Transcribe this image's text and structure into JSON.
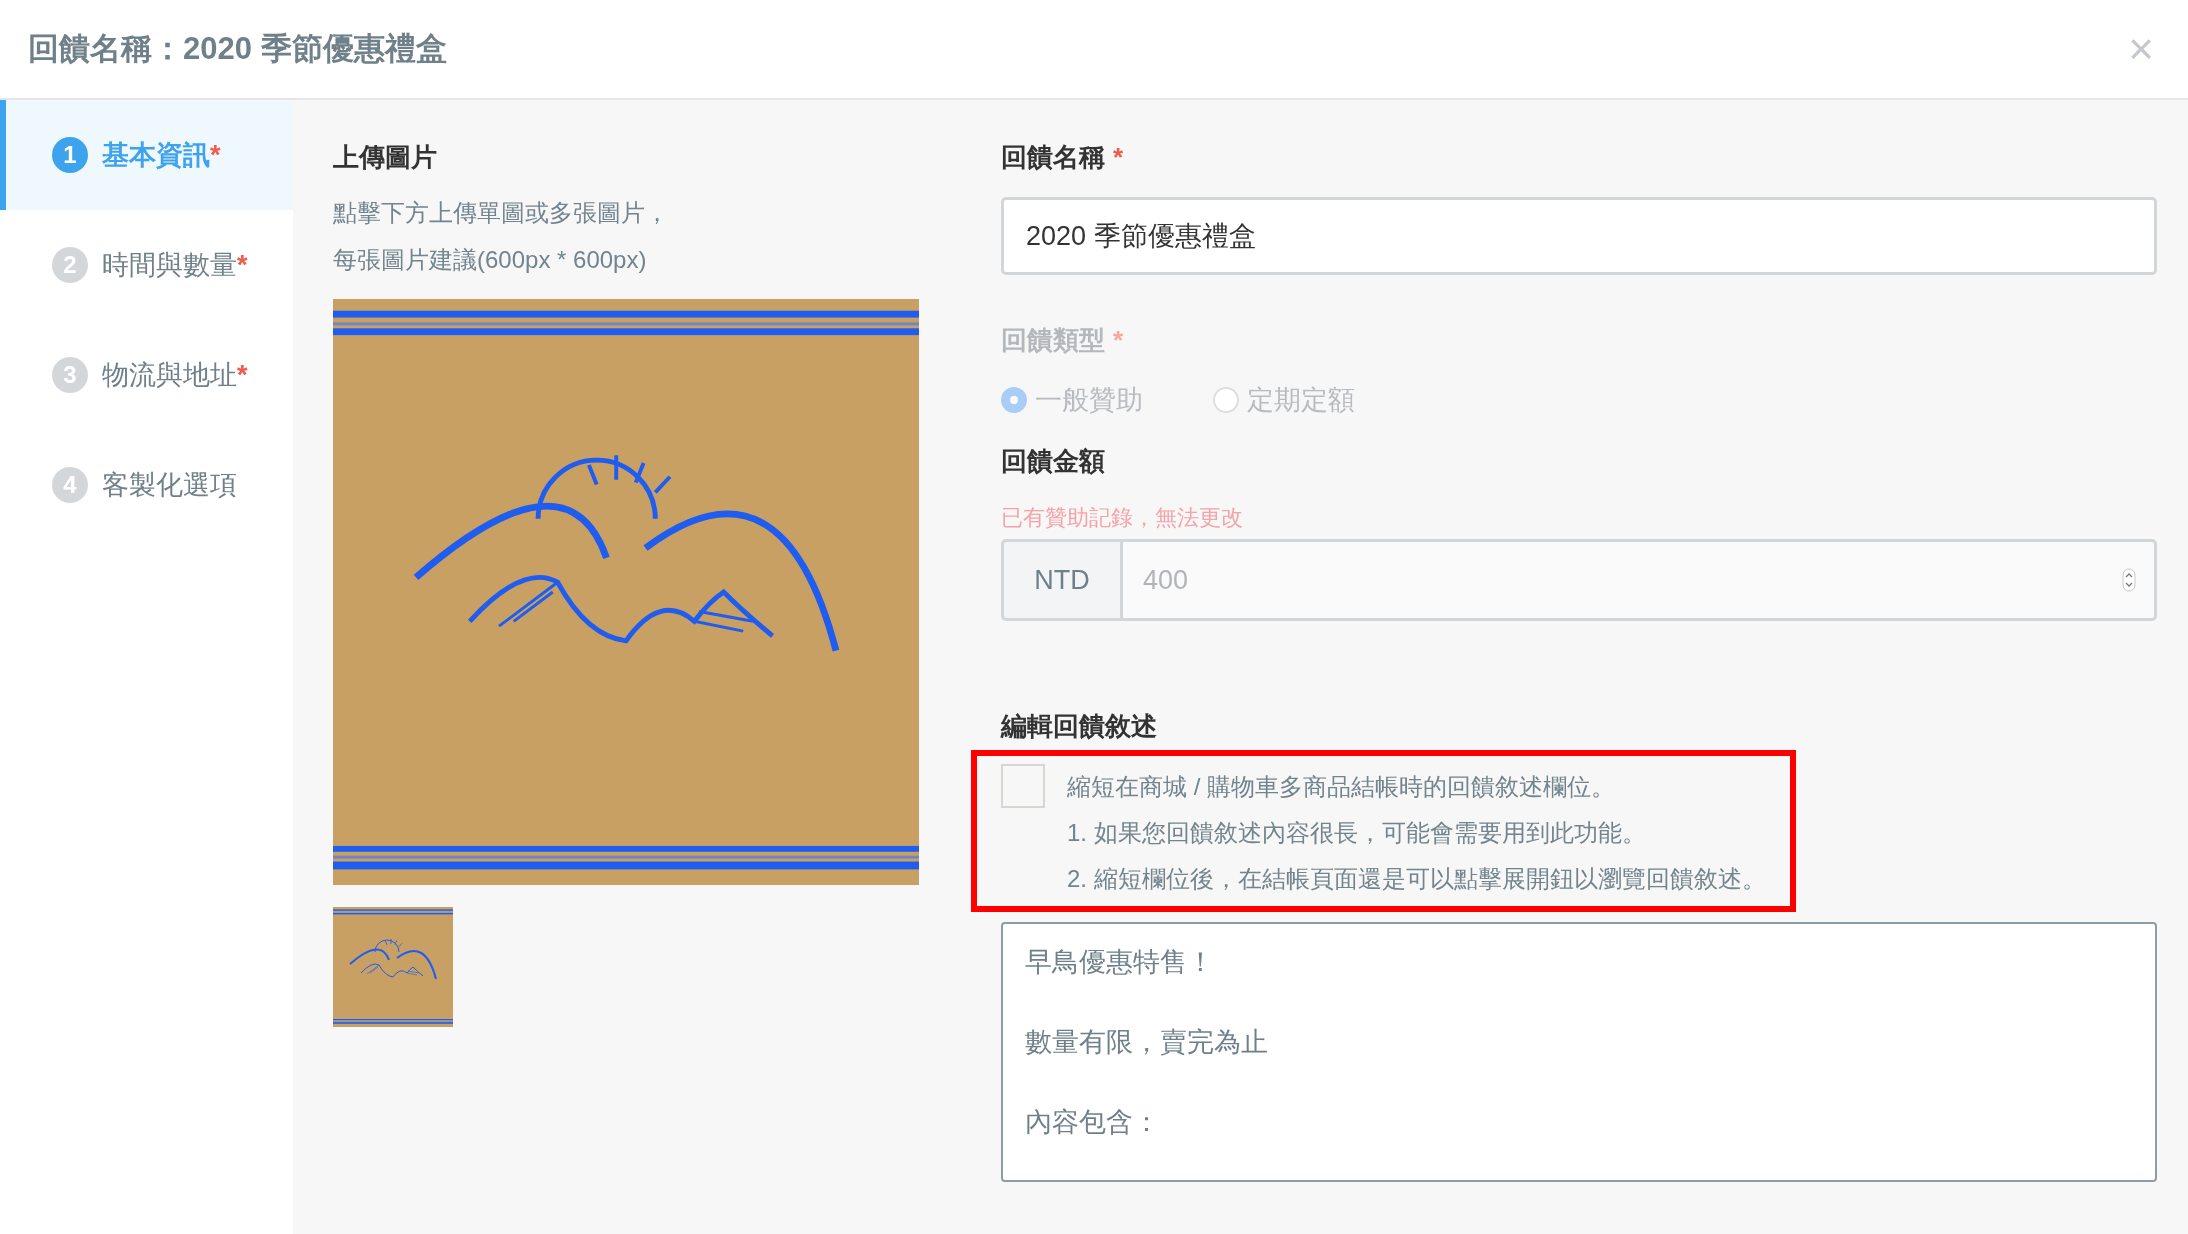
{
  "dialog": {
    "title": "回饋名稱：2020 季節優惠禮盒",
    "close": "×"
  },
  "steps": [
    {
      "number": "1",
      "label": "基本資訊",
      "mark": "*",
      "selected": true
    },
    {
      "number": "2",
      "label": "時間與數量",
      "mark": "*",
      "selected": false
    },
    {
      "number": "3",
      "label": "物流與地址",
      "mark": "*",
      "selected": false
    },
    {
      "number": "4",
      "label": "客製化選項",
      "selected": false
    }
  ],
  "upload": {
    "title": "上傳圖片",
    "hint_lines": [
      "點擊下方上傳單圖或多張圖片，",
      "每張圖片建議(600px * 600px)"
    ]
  },
  "name_field": {
    "label": "回饋名稱",
    "mark": "*",
    "value": "2020 季節優惠禮盒"
  },
  "reward_type": {
    "label": "回饋類型",
    "mark": "*",
    "disabled": true,
    "options": [
      {
        "label": "一般贊助",
        "selected": true
      },
      {
        "label": "定期定額",
        "selected": false
      }
    ]
  },
  "amount": {
    "label": "回饋金額",
    "note": "已有贊助記錄，無法更改",
    "currency": "NTD",
    "value": "400",
    "disabled": true
  },
  "description": {
    "label": "編輯回饋敘述",
    "shorten": {
      "checked": false,
      "lines": [
        "縮短在商城 / 購物車多商品結帳時的回饋敘述欄位。",
        "1. 如果您回饋敘述內容很長，可能會需要用到此功能。",
        "2. 縮短欄位後，在結帳頁面還是可以點擊展開鈕以瀏覽回饋敘述。"
      ]
    },
    "text_lines": [
      "早鳥優惠特售！",
      "數量有限，賣完為止",
      "內容包含："
    ]
  }
}
